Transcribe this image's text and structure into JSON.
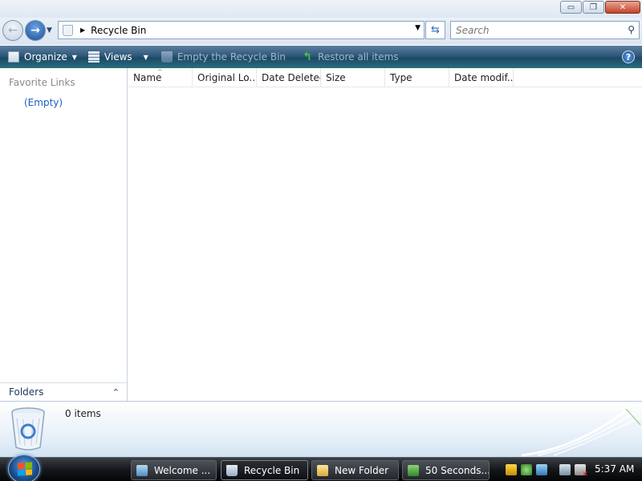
{
  "window": {
    "title": "Recycle Bin",
    "controls": {
      "minimize": "▭",
      "maximize": "❐",
      "close": "✕"
    }
  },
  "address": {
    "breadcrumb": [
      "Recycle Bin"
    ],
    "search_placeholder": "Search"
  },
  "toolbar": {
    "organize": "Organize",
    "views": "Views",
    "empty_bin": "Empty the Recycle Bin",
    "restore_all": "Restore all items",
    "help": "?"
  },
  "nav_pane": {
    "favorites_header": "Favorite Links",
    "favorites_empty": "(Empty)",
    "folders_label": "Folders"
  },
  "columns": [
    "Name",
    "Original Lo...",
    "Date Deleted",
    "Size",
    "Type",
    "Date modif..."
  ],
  "details": {
    "item_count": "0 items"
  },
  "taskbar": {
    "tasks": [
      {
        "label": "Welcome ...",
        "icon": "ie-icon"
      },
      {
        "label": "Recycle Bin",
        "icon": "recycle-bin-icon",
        "active": true
      },
      {
        "label": "New Folder",
        "icon": "folder-icon"
      },
      {
        "label": "50 Seconds...",
        "icon": "app-icon"
      }
    ],
    "clock": "5:37 AM"
  },
  "icons": {
    "back": "arrow-left-icon",
    "forward": "arrow-right-icon",
    "refresh": "refresh-icon",
    "search": "search-icon",
    "help": "help-icon"
  }
}
